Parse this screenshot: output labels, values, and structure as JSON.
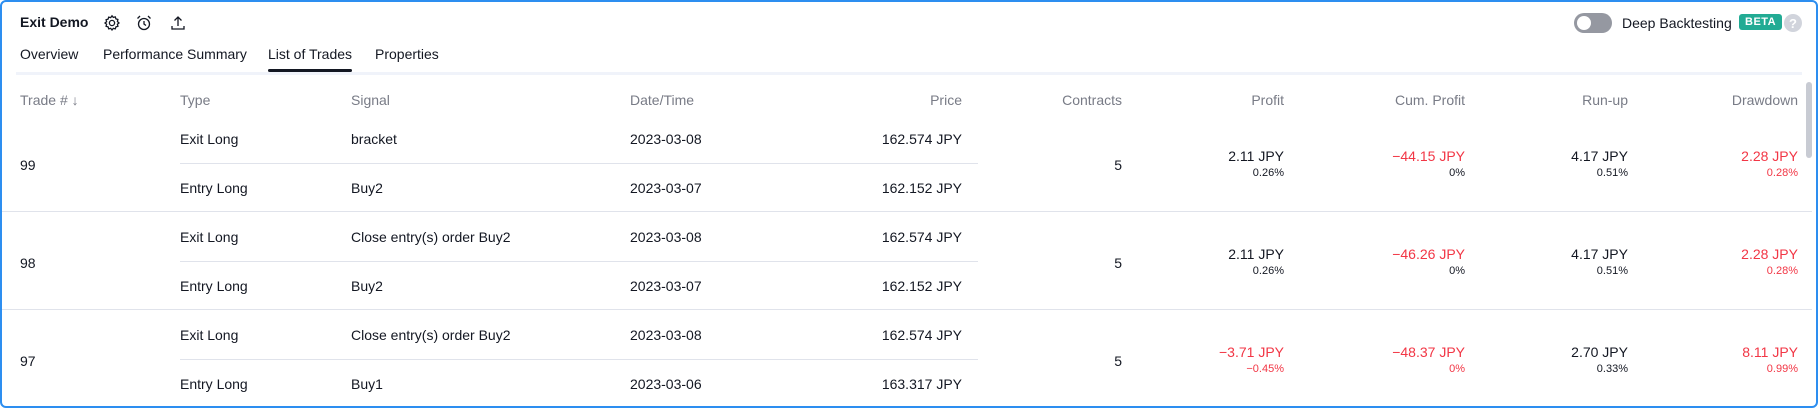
{
  "header": {
    "title": "Exit Demo"
  },
  "deep_backtesting": {
    "label": "Deep Backtesting",
    "badge": "BETA",
    "help": "?"
  },
  "tabs": [
    {
      "label": "Overview"
    },
    {
      "label": "Performance Summary"
    },
    {
      "label": "List of Trades"
    },
    {
      "label": "Properties"
    }
  ],
  "columns": {
    "trade": "Trade #",
    "sort_arrow": "↓",
    "type": "Type",
    "signal": "Signal",
    "datetime": "Date/Time",
    "price": "Price",
    "contracts": "Contracts",
    "profit": "Profit",
    "cum_profit": "Cum. Profit",
    "runup": "Run-up",
    "drawdown": "Drawdown"
  },
  "trades": [
    {
      "num": "99",
      "contracts": "5",
      "exit": {
        "type": "Exit Long",
        "signal": "bracket",
        "date": "2023-03-08",
        "price": "162.574 JPY"
      },
      "entry": {
        "type": "Entry Long",
        "signal": "Buy2",
        "date": "2023-03-07",
        "price": "162.152 JPY"
      },
      "profit": "2.11 JPY",
      "profit_pct": "0.26%",
      "cum_profit": "−44.15 JPY",
      "cum_profit_pct": "0%",
      "runup": "4.17 JPY",
      "runup_pct": "0.51%",
      "drawdown": "2.28 JPY",
      "drawdown_pct": "0.28%"
    },
    {
      "num": "98",
      "contracts": "5",
      "exit": {
        "type": "Exit Long",
        "signal": "Close entry(s) order Buy2",
        "date": "2023-03-08",
        "price": "162.574 JPY"
      },
      "entry": {
        "type": "Entry Long",
        "signal": "Buy2",
        "date": "2023-03-07",
        "price": "162.152 JPY"
      },
      "profit": "2.11 JPY",
      "profit_pct": "0.26%",
      "cum_profit": "−46.26 JPY",
      "cum_profit_pct": "0%",
      "runup": "4.17 JPY",
      "runup_pct": "0.51%",
      "drawdown": "2.28 JPY",
      "drawdown_pct": "0.28%"
    },
    {
      "num": "97",
      "contracts": "5",
      "exit": {
        "type": "Exit Long",
        "signal": "Close entry(s) order Buy2",
        "date": "2023-03-08",
        "price": "162.574 JPY"
      },
      "entry": {
        "type": "Entry Long",
        "signal": "Buy1",
        "date": "2023-03-06",
        "price": "163.317 JPY"
      },
      "profit": "−3.71 JPY",
      "profit_pct": "−0.45%",
      "cum_profit": "−48.37 JPY",
      "cum_profit_pct": "0%",
      "runup": "2.70 JPY",
      "runup_pct": "0.33%",
      "drawdown": "8.11 JPY",
      "drawdown_pct": "0.99%"
    }
  ],
  "colors": {
    "negative": "#f23645",
    "accent": "#2d8ef0",
    "beta": "#22ab94"
  }
}
